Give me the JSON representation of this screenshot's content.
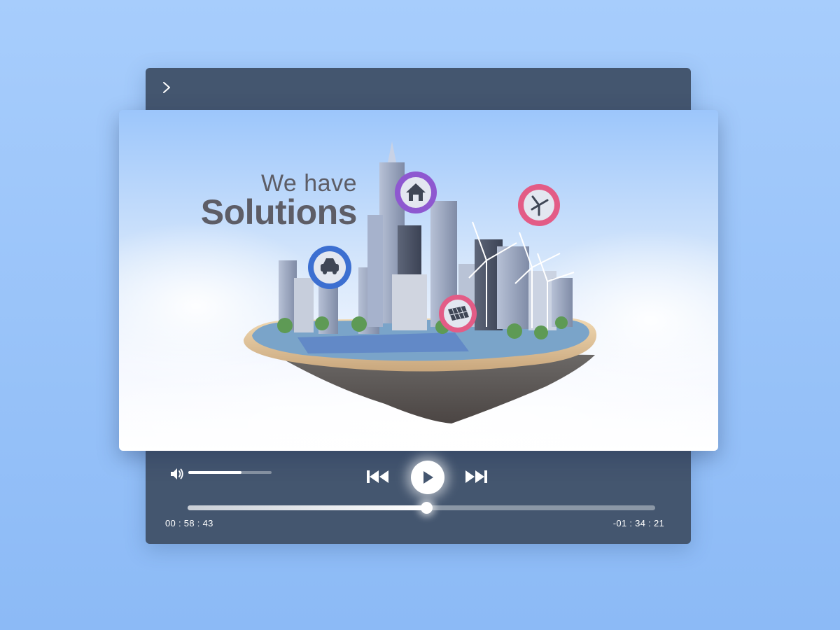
{
  "video": {
    "headline_line1": "We have",
    "headline_line2": "Solutions",
    "pins": [
      {
        "icon": "house-icon",
        "color": "#8e58d0"
      },
      {
        "icon": "car-icon",
        "color": "#3c6fd1"
      },
      {
        "icon": "wind-turbine-icon",
        "color": "#e35c86"
      },
      {
        "icon": "solar-panel-icon",
        "color": "#e35c86"
      }
    ]
  },
  "controls": {
    "collapse_icon": "chevron-right-icon",
    "volume_icon": "speaker-icon",
    "volume_level": 0.64,
    "prev_icon": "skip-previous-icon",
    "play_icon": "play-icon",
    "next_icon": "skip-next-icon",
    "progress": 0.51,
    "time_elapsed": "00 : 58 : 43",
    "time_remaining": "-01 : 34 : 21"
  },
  "colors": {
    "background": "#9ec6fa",
    "panel": "#44566f",
    "accent": "#ffffff"
  }
}
